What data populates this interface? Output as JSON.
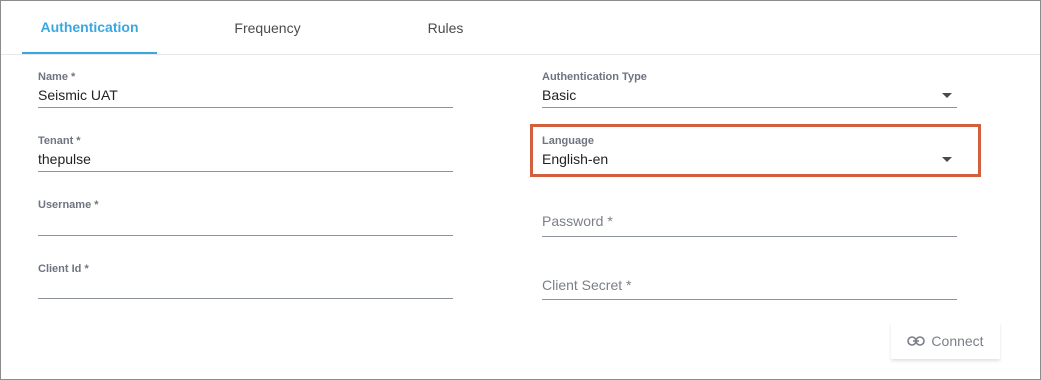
{
  "tabs": [
    {
      "label": "Authentication",
      "active": true
    },
    {
      "label": "Frequency",
      "active": false
    },
    {
      "label": "Rules",
      "active": false
    }
  ],
  "form": {
    "name": {
      "label": "Name *",
      "value": "Seismic UAT"
    },
    "tenant": {
      "label": "Tenant *",
      "value": "thepulse"
    },
    "username": {
      "label": "Username *",
      "value": ""
    },
    "client_id": {
      "label": "Client Id *",
      "value": ""
    },
    "auth_type": {
      "label": "Authentication Type",
      "value": "Basic"
    },
    "language": {
      "label": "Language",
      "value": "English-en"
    },
    "password": {
      "placeholder": "Password *"
    },
    "client_secret": {
      "placeholder": "Client Secret *"
    }
  },
  "connect_button": {
    "label": "Connect",
    "icon": "link-icon"
  },
  "colors": {
    "accent": "#3aa8e0",
    "highlight_border": "#d2603f"
  }
}
